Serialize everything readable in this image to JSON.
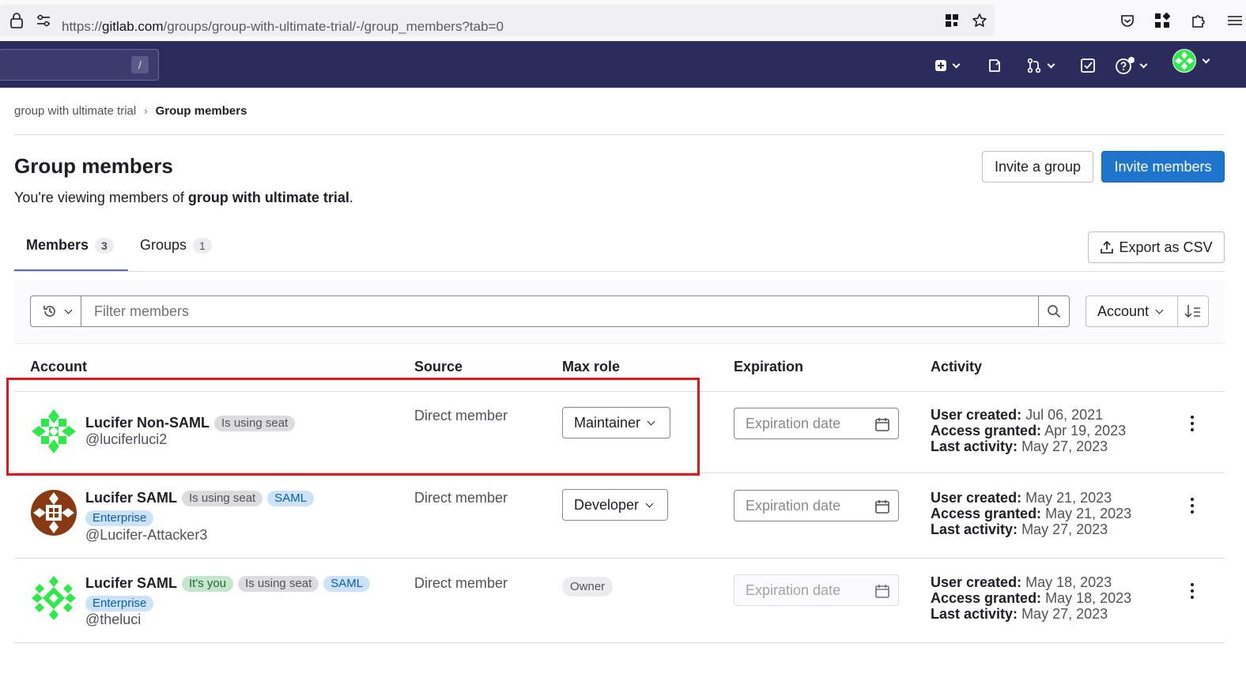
{
  "browser": {
    "url_prefix": "https://",
    "url_host": "gitlab.com",
    "url_path": "/groups/group-with-ultimate-trial/-/group_members?tab=0"
  },
  "topnav": {
    "search_shortcut": "/"
  },
  "breadcrumb": {
    "parent": "group with ultimate trial",
    "current": "Group members"
  },
  "header": {
    "title": "Group members",
    "subtitle_prefix": "You're viewing members of ",
    "subtitle_group": "group with ultimate trial",
    "subtitle_suffix": ".",
    "invite_group_label": "Invite a group",
    "invite_members_label": "Invite members"
  },
  "tabs": [
    {
      "label": "Members",
      "count": "3"
    },
    {
      "label": "Groups",
      "count": "1"
    }
  ],
  "export_label": "Export as CSV",
  "filter": {
    "placeholder": "Filter members",
    "sort_label": "Account"
  },
  "table": {
    "columns": [
      "Account",
      "Source",
      "Max role",
      "Expiration",
      "Activity"
    ],
    "rows": [
      {
        "name": "Lucifer Non-SAML",
        "badges": [
          "Is using seat"
        ],
        "enterprise": "",
        "handle": "@luciferluci2",
        "source": "Direct member",
        "role": "Maintainer",
        "expiration_placeholder": "Expiration date",
        "user_created_label": "User created:",
        "user_created": "Jul 06, 2021",
        "access_granted_label": "Access granted:",
        "access_granted": "Apr 19, 2023",
        "last_activity_label": "Last activity:",
        "last_activity": "May 27, 2023"
      },
      {
        "name": "Lucifer SAML",
        "badges": [
          "Is using seat",
          "SAML"
        ],
        "enterprise": "Enterprise",
        "handle": "@Lucifer-Attacker3",
        "source": "Direct member",
        "role": "Developer",
        "expiration_placeholder": "Expiration date",
        "user_created_label": "User created:",
        "user_created": "May 21, 2023",
        "access_granted_label": "Access granted:",
        "access_granted": "May 21, 2023",
        "last_activity_label": "Last activity:",
        "last_activity": "May 27, 2023"
      },
      {
        "name": "Lucifer SAML",
        "badges": [
          "It's you",
          "Is using seat",
          "SAML"
        ],
        "enterprise": "Enterprise",
        "handle": "@theluci",
        "source": "Direct member",
        "role": "Owner",
        "expiration_placeholder": "Expiration date",
        "user_created_label": "User created:",
        "user_created": "May 18, 2023",
        "access_granted_label": "Access granted:",
        "access_granted": "May 18, 2023",
        "last_activity_label": "Last activity:",
        "last_activity": "May 27, 2023"
      }
    ]
  },
  "colors": {
    "nav_bg": "#2b2b5c",
    "primary": "#1f75cb",
    "highlight": "#e0161e",
    "avatar_green": "#2fe84a",
    "avatar_brown": "#8a3a12"
  }
}
